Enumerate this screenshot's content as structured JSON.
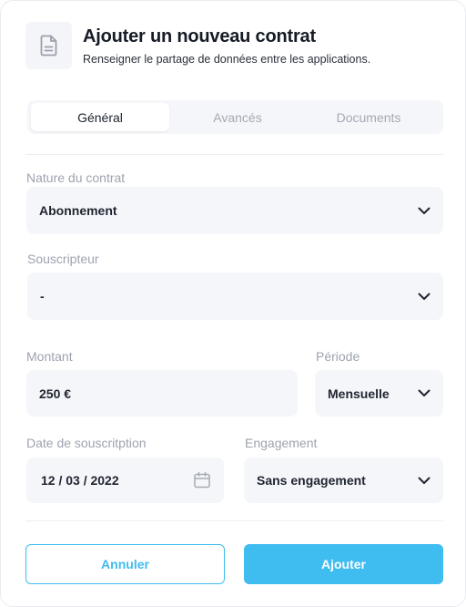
{
  "modal": {
    "header_icon": "document-icon",
    "title": "Ajouter un nouveau contrat",
    "subtitle": "Renseigner le partage de données entre les applications."
  },
  "tabs": [
    {
      "label": "Général",
      "active": true
    },
    {
      "label": "Avancés",
      "active": false
    },
    {
      "label": "Documents",
      "active": false
    }
  ],
  "form": {
    "nature": {
      "label": "Nature du contrat",
      "value": "Abonnement"
    },
    "souscripteur": {
      "label": "Souscripteur",
      "value": "-"
    },
    "montant": {
      "label": "Montant",
      "value": "250 €"
    },
    "periode": {
      "label": "Période",
      "value": "Mensuelle"
    },
    "date": {
      "label": "Date de souscritption",
      "value": "12 / 03 / 2022"
    },
    "engagement": {
      "label": "Engagement",
      "value": "Sans engagement"
    }
  },
  "actions": {
    "cancel_label": "Annuler",
    "add_label": "Ajouter"
  },
  "colors": {
    "accent": "#3fbcf0",
    "field_bg": "#f5f6f9",
    "label": "#9da3ae"
  }
}
